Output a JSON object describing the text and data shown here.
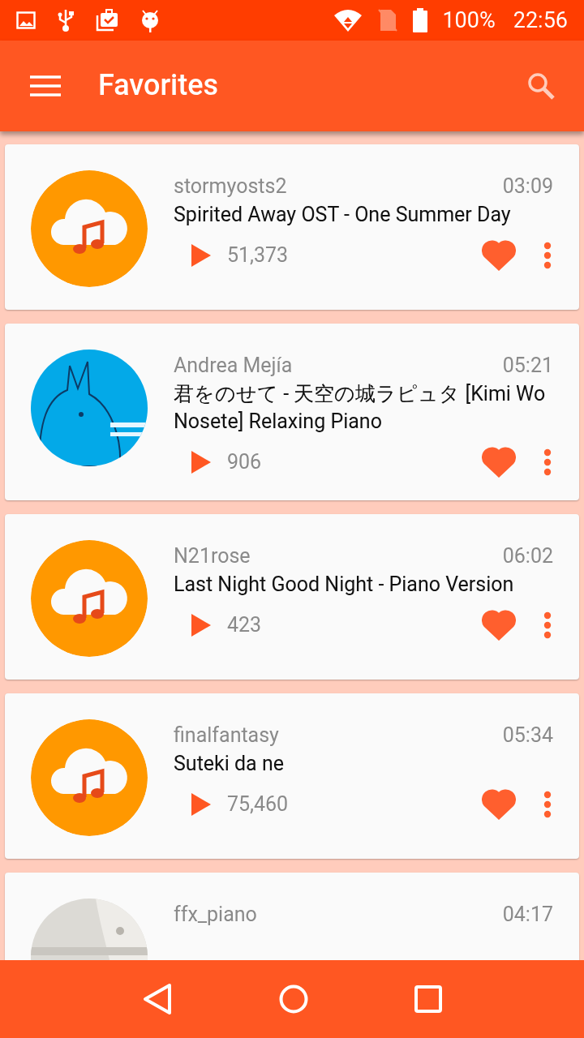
{
  "status_bar": {
    "battery": "100%",
    "time": "22:56"
  },
  "app_bar": {
    "title": "Favorites"
  },
  "tracks": [
    {
      "artwork": {
        "kind": "cloud"
      },
      "user": "stormyosts2",
      "duration": "03:09",
      "title": "Spirited Away OST - One Summer Day",
      "plays": "51,373",
      "favorite": true
    },
    {
      "user": "Andrea Mejía",
      "duration": "05:21",
      "title": "君をのせて - 天空の城ラピュタ [Kimi Wo Nosete] Relaxing Piano",
      "plays": "906",
      "favorite": true
    },
    {
      "artwork": {
        "kind": "cloud"
      },
      "user": "N21rose",
      "duration": "06:02",
      "title": "Last Night Good Night - Piano Version",
      "plays": "423",
      "favorite": true
    },
    {
      "artwork": {
        "kind": "cloud"
      },
      "user": "finalfantasy",
      "duration": "05:34",
      "title": "Suteki da ne",
      "plays": "75,460",
      "favorite": true
    },
    {
      "user": "ffx_piano",
      "duration": "04:17"
    }
  ]
}
